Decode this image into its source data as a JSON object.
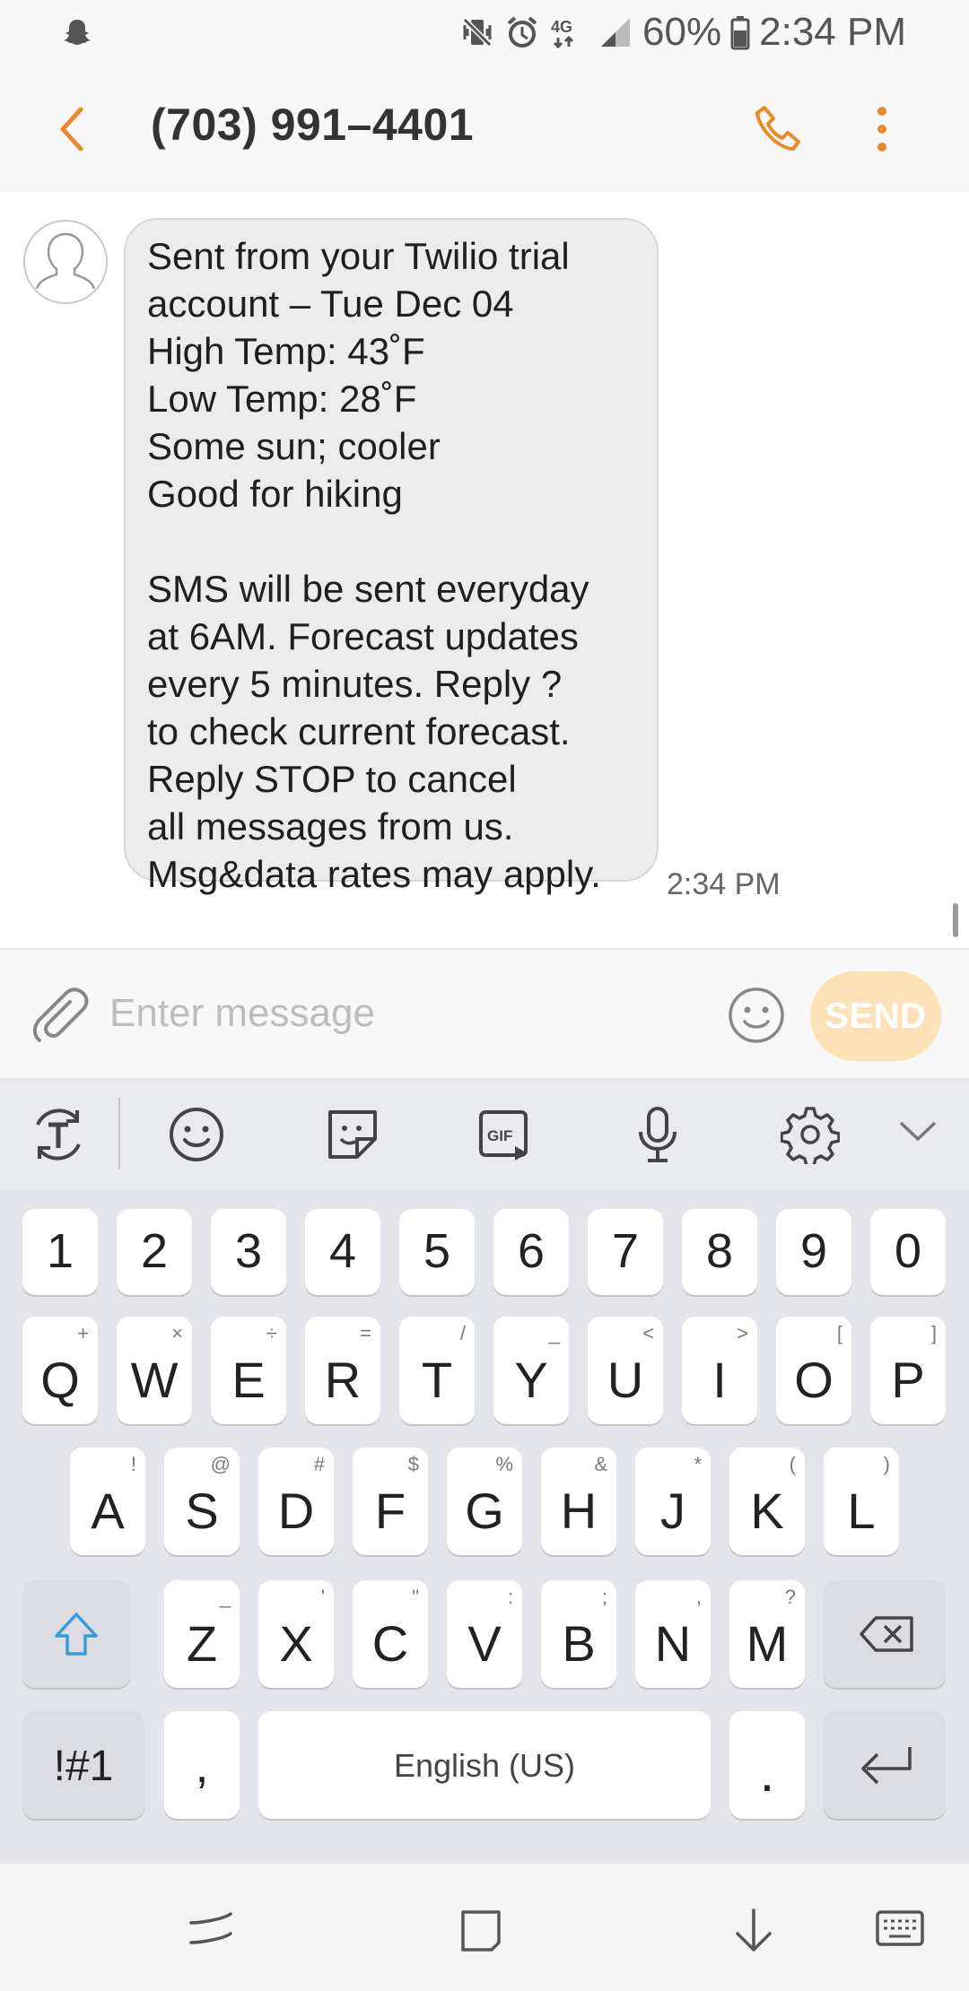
{
  "status_bar": {
    "battery": "60%",
    "time": "2:34 PM",
    "network": "4G"
  },
  "header": {
    "title": "(703) 991–4401"
  },
  "message": {
    "lines": [
      "Sent from your Twilio trial",
      "account – Tue Dec 04",
      "High Temp: 43˚F",
      "Low Temp: 28˚F",
      "Some sun; cooler",
      "Good for hiking",
      "",
      "SMS will be sent everyday",
      "at 6AM. Forecast updates",
      "every 5 minutes. Reply ?",
      "to check current forecast.",
      "Reply STOP to cancel",
      "all messages from us.",
      "Msg&data rates may apply."
    ],
    "time": "2:34 PM"
  },
  "composer": {
    "placeholder": "Enter message",
    "value": "",
    "send_label": "SEND"
  },
  "keyboard": {
    "number_row": [
      "1",
      "2",
      "3",
      "4",
      "5",
      "6",
      "7",
      "8",
      "9",
      "0"
    ],
    "row1": [
      {
        "key": "Q",
        "alt": "+"
      },
      {
        "key": "W",
        "alt": "×"
      },
      {
        "key": "E",
        "alt": "÷"
      },
      {
        "key": "R",
        "alt": "="
      },
      {
        "key": "T",
        "alt": "/"
      },
      {
        "key": "Y",
        "alt": "_"
      },
      {
        "key": "U",
        "alt": "<"
      },
      {
        "key": "I",
        "alt": ">"
      },
      {
        "key": "O",
        "alt": "["
      },
      {
        "key": "P",
        "alt": "]"
      }
    ],
    "row2": [
      {
        "key": "A",
        "alt": "!"
      },
      {
        "key": "S",
        "alt": "@"
      },
      {
        "key": "D",
        "alt": "#"
      },
      {
        "key": "F",
        "alt": "$"
      },
      {
        "key": "G",
        "alt": "%"
      },
      {
        "key": "H",
        "alt": "&"
      },
      {
        "key": "J",
        "alt": "*"
      },
      {
        "key": "K",
        "alt": "("
      },
      {
        "key": "L",
        "alt": ")"
      }
    ],
    "row3": [
      {
        "key": "Z",
        "alt": "_"
      },
      {
        "key": "X",
        "alt": "'"
      },
      {
        "key": "C",
        "alt": "\""
      },
      {
        "key": "V",
        "alt": ":"
      },
      {
        "key": "B",
        "alt": ";"
      },
      {
        "key": "N",
        "alt": ","
      },
      {
        "key": "M",
        "alt": "?"
      }
    ],
    "symbols_label": "!#1",
    "comma": ",",
    "space_label": "English (US)",
    "period": "."
  },
  "colors": {
    "accent": "#e98b2a",
    "send_disabled": "#fde2b8",
    "bubble": "#ececec"
  }
}
